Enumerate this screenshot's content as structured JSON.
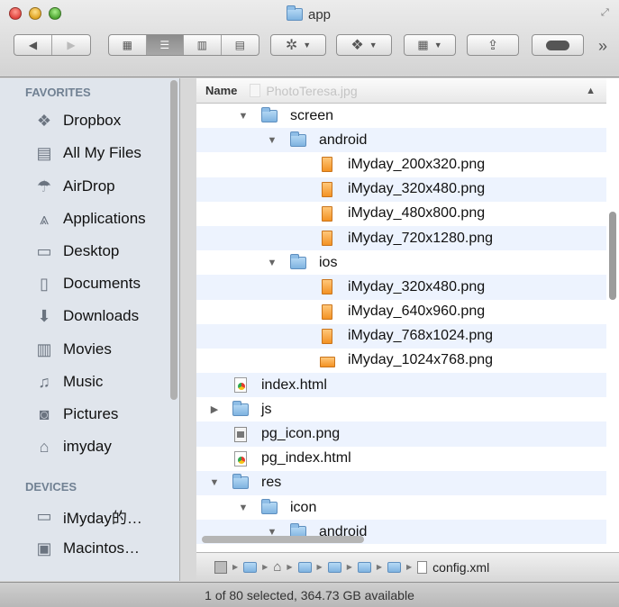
{
  "window": {
    "title": "app"
  },
  "toolbar": {
    "back_icon": "chevron-left-icon",
    "forward_icon": "chevron-right-icon",
    "view_modes": [
      "icon-view",
      "list-view",
      "column-view",
      "coverflow-view"
    ],
    "active_view": "list-view",
    "action_icon": "gear-icon",
    "dropbox_icon": "dropbox-icon",
    "arrange_icon": "arrange-icon",
    "share_icon": "share-icon",
    "tags_icon": "toggle-icon",
    "overflow": "»"
  },
  "sidebar": {
    "favorites_header": "FAVORITES",
    "favorites": [
      {
        "label": "Dropbox",
        "icon": "dropbox-icon"
      },
      {
        "label": "All My Files",
        "icon": "all-files-icon"
      },
      {
        "label": "AirDrop",
        "icon": "airdrop-icon"
      },
      {
        "label": "Applications",
        "icon": "applications-icon"
      },
      {
        "label": "Desktop",
        "icon": "desktop-icon"
      },
      {
        "label": "Documents",
        "icon": "documents-icon"
      },
      {
        "label": "Downloads",
        "icon": "downloads-icon"
      },
      {
        "label": "Movies",
        "icon": "movies-icon"
      },
      {
        "label": "Music",
        "icon": "music-icon"
      },
      {
        "label": "Pictures",
        "icon": "pictures-icon"
      },
      {
        "label": "imyday",
        "icon": "home-icon"
      }
    ],
    "devices_header": "DEVICES",
    "devices": [
      {
        "label": "iMyday的…",
        "icon": "laptop-icon"
      },
      {
        "label": "Macintos…",
        "icon": "disk-icon"
      }
    ]
  },
  "list": {
    "column_name": "Name",
    "ghost_label": "PhotoTeresa.jpg",
    "rows": [
      {
        "label": "screen",
        "type": "folder",
        "indent": 1,
        "disclosure": "open"
      },
      {
        "label": "android",
        "type": "folder",
        "indent": 2,
        "disclosure": "open"
      },
      {
        "label": "iMyday_200x320.png",
        "type": "png",
        "indent": 3
      },
      {
        "label": "iMyday_320x480.png",
        "type": "png",
        "indent": 3
      },
      {
        "label": "iMyday_480x800.png",
        "type": "png",
        "indent": 3
      },
      {
        "label": "iMyday_720x1280.png",
        "type": "png",
        "indent": 3
      },
      {
        "label": "ios",
        "type": "folder",
        "indent": 2,
        "disclosure": "open"
      },
      {
        "label": "iMyday_320x480.png",
        "type": "png",
        "indent": 3
      },
      {
        "label": "iMyday_640x960.png",
        "type": "png",
        "indent": 3
      },
      {
        "label": "iMyday_768x1024.png",
        "type": "png",
        "indent": 3
      },
      {
        "label": "iMyday_1024x768.png",
        "type": "png-landscape",
        "indent": 3
      },
      {
        "label": "index.html",
        "type": "html",
        "indent": 0
      },
      {
        "label": "js",
        "type": "folder",
        "indent": 0,
        "disclosure": "closed"
      },
      {
        "label": "pg_icon.png",
        "type": "generic",
        "indent": 0
      },
      {
        "label": "pg_index.html",
        "type": "html",
        "indent": 0
      },
      {
        "label": "res",
        "type": "folder",
        "indent": 0,
        "disclosure": "open"
      },
      {
        "label": "icon",
        "type": "folder",
        "indent": 1,
        "disclosure": "open"
      },
      {
        "label": "android",
        "type": "folder",
        "indent": 2,
        "disclosure": "open"
      }
    ]
  },
  "pathbar": {
    "last_item": "config.xml"
  },
  "status": {
    "text": "1 of 80 selected, 364.73 GB available"
  }
}
